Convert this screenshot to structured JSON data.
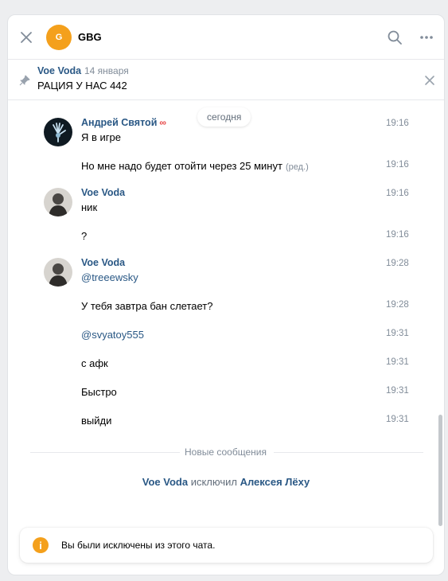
{
  "header": {
    "avatar_letter": "G",
    "title": "GBG",
    "accent_color": "#f4a01c"
  },
  "pinned": {
    "author": "Voe Voda",
    "date": "14 января",
    "text": "РАЦИЯ У НАС 442"
  },
  "date_pill": "сегодня",
  "messages": [
    {
      "author": "Андрей Святой",
      "author_badge": "∞",
      "text": "Я в игре",
      "time": "19:16"
    },
    {
      "text": "Но мне надо будет отойти через 25 минут",
      "edited": "(ред.)",
      "time": "19:16"
    },
    {
      "author": "Voe Voda",
      "text": "ник",
      "time": "19:16"
    },
    {
      "text": "?",
      "time": "19:16"
    },
    {
      "author": "Voe Voda",
      "text": "@treeewsky",
      "time": "19:28"
    },
    {
      "text": "У тебя завтра бан слетает?",
      "time": "19:28"
    },
    {
      "text": "@svyatoy555",
      "time": "19:31"
    },
    {
      "text": "с афк",
      "time": "19:31"
    },
    {
      "text": "Быстро",
      "time": "19:31"
    },
    {
      "text": "выйди",
      "time": "19:31"
    }
  ],
  "new_messages_label": "Новые сообщения",
  "system": {
    "actor": "Voe Voda",
    "action": "исключил",
    "target": "Алексея Лёху"
  },
  "notice": {
    "icon": "info-icon",
    "text": "Вы были исключены из этого чата."
  }
}
